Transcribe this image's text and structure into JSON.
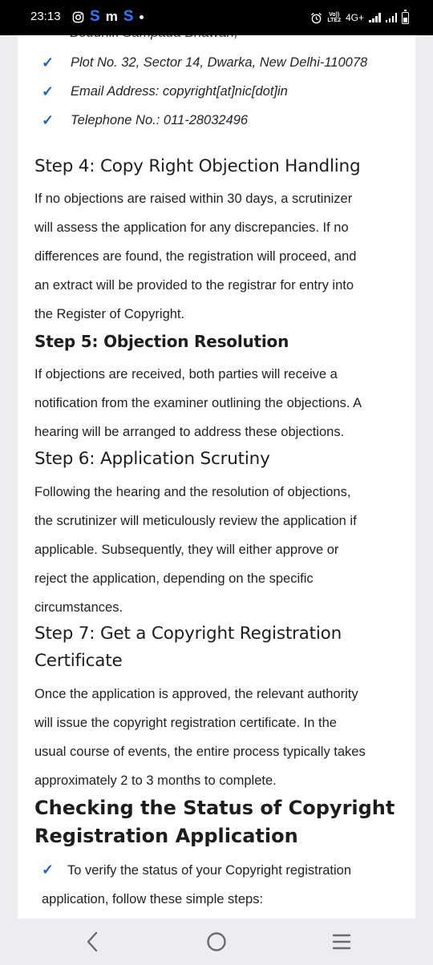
{
  "status_bar": {
    "time": "23:13",
    "network": "4G+",
    "volte_line1": "Vo))",
    "volte_line2": "LTE2"
  },
  "article": {
    "clipped_top_line": "Bouunik Sampada Bhawan,",
    "address_items": [
      "Plot No. 32, Sector 14, Dwarka, New Delhi-110078",
      "Email Address: copyright[at]nic[dot]in",
      "Telephone No.: 011-28032496"
    ],
    "steps": [
      {
        "heading": "Step 4: Copy Right Objection Handling",
        "lines": [
          "If no objections are raised within 30 days, a scrutinizer",
          "will assess the application for any discrepancies. If no",
          "differences are found, the registration will proceed, and",
          "an extract will be provided to the registrar for entry into",
          "the Register of Copyright."
        ]
      },
      {
        "heading": "Step 5: Objection Resolution",
        "lines": [
          "If objections are received, both parties will receive a",
          "notification from the examiner outlining the objections. A",
          "hearing will be arranged to address these objections."
        ]
      },
      {
        "heading": "Step 6: Application Scrutiny",
        "lines": [
          "Following the hearing and the resolution of objections,",
          "the scrutinizer will meticulously review the application if",
          "applicable. Subsequently, they will either approve or",
          "reject the application, depending on the specific",
          "circumstances."
        ]
      },
      {
        "heading_line1": "Step 7: Get a Copyright Registration",
        "heading_line2": "Certificate",
        "lines": [
          "Once the application is approved, the relevant authority",
          "will issue the copyright registration certificate. In the",
          "usual course of events, the entire process typically takes",
          "approximately 2 to 3 months to complete."
        ]
      }
    ],
    "section_heading_line1": "Checking the Status of Copyright",
    "section_heading_line2": "Registration Application",
    "status_items": [
      {
        "line1": "To verify the status of your Copyright registration",
        "line2": "application, follow these simple steps:"
      }
    ]
  },
  "icons": {
    "checkmark": "check-icon",
    "back": "back-icon",
    "home": "home-icon",
    "recents": "recents-icon"
  },
  "colors": {
    "checkmark": "#1b63c6",
    "sms_brand": "#2b7bff"
  }
}
